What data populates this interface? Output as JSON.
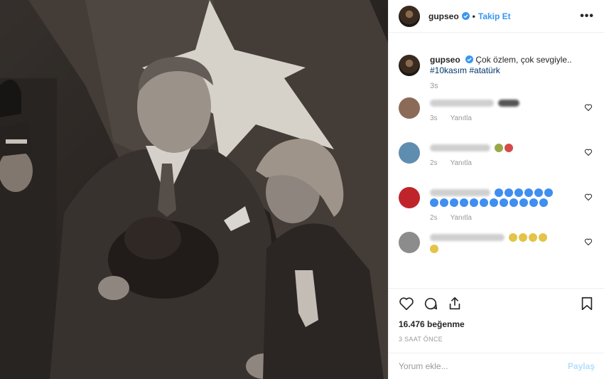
{
  "photo": {
    "description_icon": "historic-photo"
  },
  "header": {
    "username": "gupseo",
    "separator": "•",
    "follow_label": "Takip Et",
    "more_label": "•••"
  },
  "caption": {
    "username": "gupseo",
    "text": "Çok özlem, çok sevgiyle..",
    "hashtags": "#10kasım #atatürk",
    "time": "3s"
  },
  "comments": [
    {
      "time": "3s",
      "reply": "Yanıtla",
      "avatar_color": "#8b6b58",
      "emoji_color": "#3a3a3a"
    },
    {
      "time": "2s",
      "reply": "Yanıtla",
      "avatar_color": "#5f8db0",
      "emoji_color": "#d64a4a"
    },
    {
      "time": "2s",
      "reply": "Yanıtla",
      "avatar_color": "#c0242b",
      "emoji_color": "#3f8ef0"
    },
    {
      "reply": "",
      "avatar_color": "#8c8c8c",
      "emoji_color": "#e3c34a"
    }
  ],
  "actions": {
    "like_icon": "heart-icon",
    "comment_icon": "comment-icon",
    "share_icon": "share-icon",
    "save_icon": "bookmark-icon"
  },
  "likes": "16.476 beğenme",
  "posted_ago": "3 SAAT ÖNCE",
  "add_comment": {
    "placeholder": "Yorum ekle...",
    "post_label": "Paylaş"
  },
  "colors": {
    "link": "#3897f0",
    "hashtag": "#003569",
    "muted": "#999999",
    "post_disabled": "#b2dffc"
  }
}
